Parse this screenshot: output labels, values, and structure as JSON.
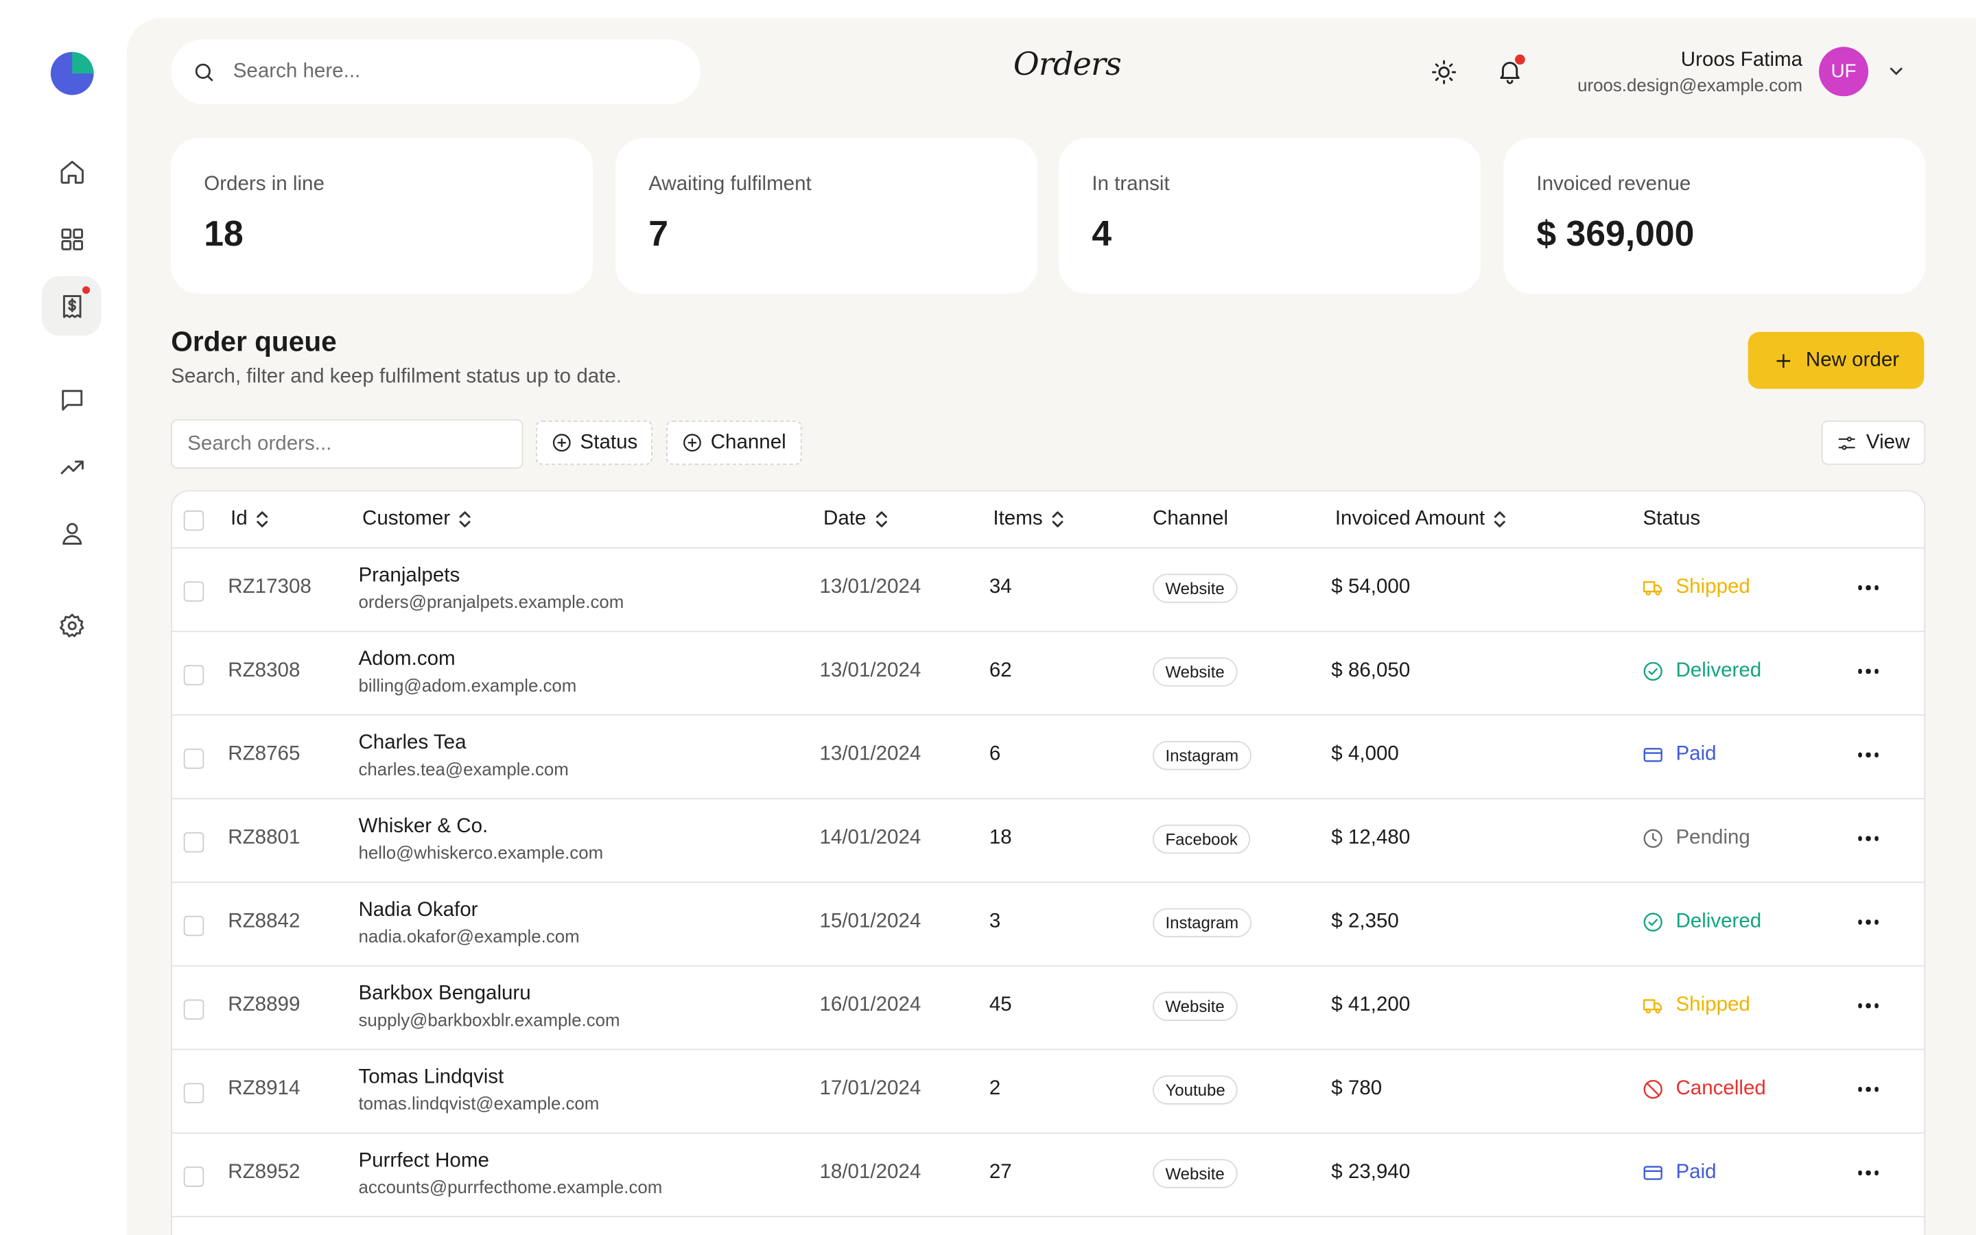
{
  "page": {
    "title": "Orders"
  },
  "search": {
    "placeholder": "Search here..."
  },
  "user": {
    "name": "Uroos Fatima",
    "email": "uroos.design@example.com",
    "initials": "UF"
  },
  "sidebar": {
    "items": [
      {
        "name": "home",
        "icon": "home-icon"
      },
      {
        "name": "dashboard",
        "icon": "grid-icon"
      },
      {
        "name": "orders",
        "icon": "invoice-icon",
        "active": true,
        "notification": true
      },
      {
        "name": "messages",
        "icon": "chat-icon"
      },
      {
        "name": "analytics",
        "icon": "trending-up-icon"
      },
      {
        "name": "profile",
        "icon": "user-icon"
      },
      {
        "name": "settings",
        "icon": "gear-icon"
      }
    ]
  },
  "stats": [
    {
      "label": "Orders in line",
      "value": "18"
    },
    {
      "label": "Awaiting fulfilment",
      "value": "7"
    },
    {
      "label": "In transit",
      "value": "4"
    },
    {
      "label": "Invoiced revenue",
      "value": "$ 369,000"
    }
  ],
  "queue": {
    "title": "Order queue",
    "subtitle": "Search, filter and keep fulfilment status up to date.",
    "new_button": "New order",
    "search_placeholder": "Search orders...",
    "filters": {
      "status": "Status",
      "channel": "Channel",
      "view": "View"
    }
  },
  "table": {
    "columns": {
      "id": "Id",
      "customer": "Customer",
      "date": "Date",
      "items": "Items",
      "channel": "Channel",
      "amount": "Invoiced Amount",
      "status": "Status"
    },
    "rows": [
      {
        "id": "RZ17308",
        "customer": "Pranjalpets",
        "email": "orders@pranjalpets.example.com",
        "date": "13/01/2024",
        "items": "34",
        "channel": "Website",
        "amount": "$ 54,000",
        "status": "Shipped"
      },
      {
        "id": "RZ8308",
        "customer": "Adom.com",
        "email": "billing@adom.example.com",
        "date": "13/01/2024",
        "items": "62",
        "channel": "Website",
        "amount": "$ 86,050",
        "status": "Delivered"
      },
      {
        "id": "RZ8765",
        "customer": "Charles Tea",
        "email": "charles.tea@example.com",
        "date": "13/01/2024",
        "items": "6",
        "channel": "Instagram",
        "amount": "$ 4,000",
        "status": "Paid"
      },
      {
        "id": "RZ8801",
        "customer": "Whisker & Co.",
        "email": "hello@whiskerco.example.com",
        "date": "14/01/2024",
        "items": "18",
        "channel": "Facebook",
        "amount": "$ 12,480",
        "status": "Pending"
      },
      {
        "id": "RZ8842",
        "customer": "Nadia Okafor",
        "email": "nadia.okafor@example.com",
        "date": "15/01/2024",
        "items": "3",
        "channel": "Instagram",
        "amount": "$ 2,350",
        "status": "Delivered"
      },
      {
        "id": "RZ8899",
        "customer": "Barkbox Bengaluru",
        "email": "supply@barkboxblr.example.com",
        "date": "16/01/2024",
        "items": "45",
        "channel": "Website",
        "amount": "$ 41,200",
        "status": "Shipped"
      },
      {
        "id": "RZ8914",
        "customer": "Tomas Lindqvist",
        "email": "tomas.lindqvist@example.com",
        "date": "17/01/2024",
        "items": "2",
        "channel": "Youtube",
        "amount": "$ 780",
        "status": "Cancelled"
      },
      {
        "id": "RZ8952",
        "customer": "Purrfect Home",
        "email": "accounts@purrfecthome.example.com",
        "date": "18/01/2024",
        "items": "27",
        "channel": "Website",
        "amount": "$ 23,940",
        "status": "Paid"
      }
    ]
  },
  "status_styles": {
    "Shipped": {
      "color": "#f0b400",
      "icon": "truck-icon"
    },
    "Delivered": {
      "color": "#14a37f",
      "icon": "check-circle-icon"
    },
    "Paid": {
      "color": "#3f5bd8",
      "icon": "credit-card-icon"
    },
    "Pending": {
      "color": "#6b6b6b",
      "icon": "clock-icon"
    },
    "Cancelled": {
      "color": "#e5322d",
      "icon": "ban-icon"
    }
  },
  "colors": {
    "accent": "#f4c21c",
    "avatar": "#cf3fc8",
    "logo_primary": "#4d5fdc",
    "logo_secondary": "#19b38f",
    "notification": "#e5322d"
  }
}
